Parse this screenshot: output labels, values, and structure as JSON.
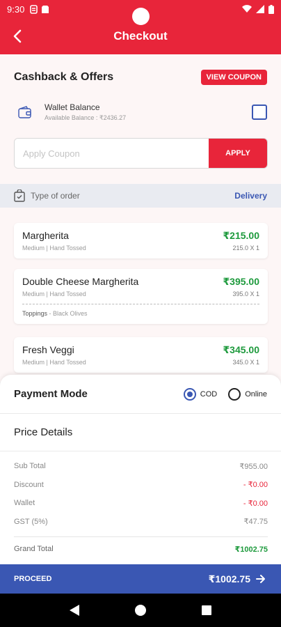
{
  "status_bar": {
    "time": "9:30"
  },
  "app_bar": {
    "title": "Checkout"
  },
  "offers": {
    "title": "Cashback & Offers",
    "view_coupon_label": "VIEW COUPON",
    "wallet": {
      "label": "Wallet Balance",
      "balance": "Available Balance : ₹2436.27",
      "checked": false
    },
    "coupon": {
      "placeholder": "Apply Coupon",
      "value": "",
      "apply_label": "APPLY"
    }
  },
  "order_type": {
    "label": "Type of order",
    "value": "Delivery"
  },
  "items": [
    {
      "name": "Margherita",
      "meta": "Medium  |  Hand Tossed",
      "price": "₹215.00",
      "qty": "215.0 X 1"
    },
    {
      "name": "Double Cheese Margherita",
      "meta": "Medium  |  Hand Tossed",
      "price": "₹395.00",
      "qty": "395.0 X 1",
      "toppings_label": "Toppings",
      "toppings": " -  Black Olives"
    },
    {
      "name": "Fresh Veggi",
      "meta": "Medium  |  Hand Tossed",
      "price": "₹345.00",
      "qty": "345.0 X 1"
    }
  ],
  "payment": {
    "title": "Payment Mode",
    "options": [
      {
        "label": "COD",
        "selected": true
      },
      {
        "label": "Online",
        "selected": false
      }
    ]
  },
  "price_details": {
    "title": "Price Details",
    "rows": [
      {
        "label": "Sub Total",
        "value": "₹955.00"
      },
      {
        "label": "Discount",
        "value": "- ₹0.00"
      },
      {
        "label": "Wallet",
        "value": "- ₹0.00"
      },
      {
        "label": "GST (5%)",
        "value": "₹47.75"
      }
    ],
    "grand_total_label": "Grand Total",
    "grand_total_value": "₹1002.75"
  },
  "proceed": {
    "label": "PROCEED",
    "total": "₹1002.75"
  },
  "colors": {
    "brand_red": "#e8253a",
    "accent_blue": "#3a57b3",
    "price_green": "#1e9a3d"
  },
  "icons": [
    "back-arrow-icon",
    "wallet-icon",
    "order-bag-icon",
    "arrow-right-icon",
    "nav-back-icon",
    "nav-home-icon",
    "nav-recents-icon"
  ]
}
